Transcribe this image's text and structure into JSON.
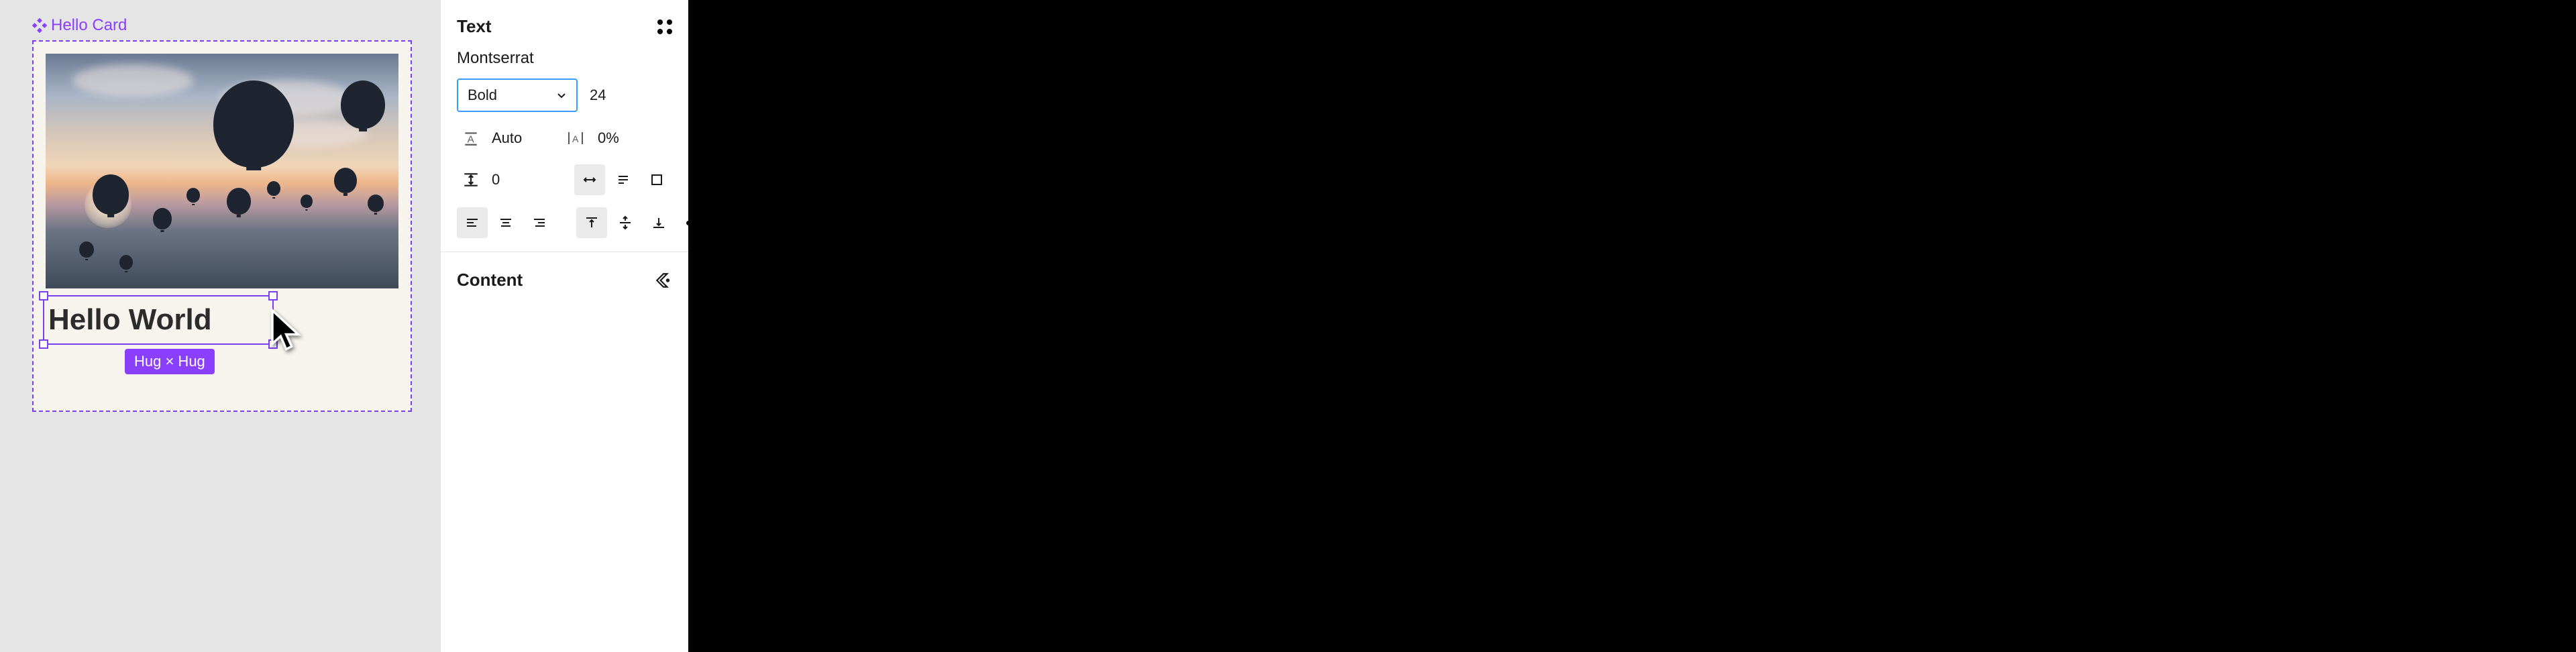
{
  "canvas": {
    "component_label": "Hello Card",
    "text_content": "Hello World",
    "resize_badge": "Hug × Hug"
  },
  "panel": {
    "text_section_title": "Text",
    "font_family": "Montserrat",
    "font_weight": "Bold",
    "font_size": "24",
    "line_height_mode": "Auto",
    "letter_spacing": "0%",
    "paragraph_spacing": "0",
    "content_section_title": "Content"
  }
}
